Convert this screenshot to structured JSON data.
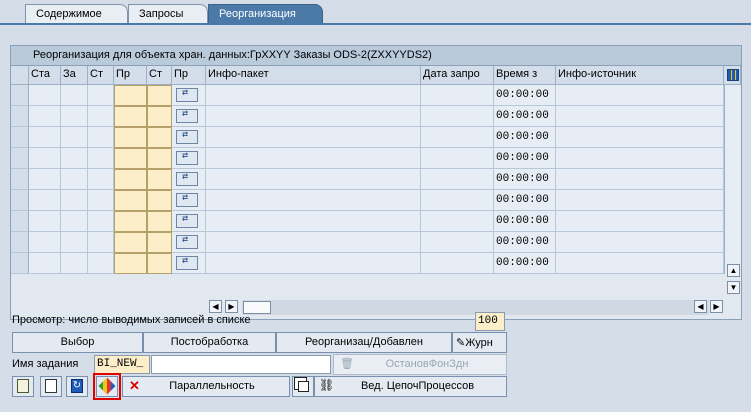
{
  "tabs": [
    {
      "label": "Содержимое"
    },
    {
      "label": "Запросы"
    },
    {
      "label": "Реорганизация"
    }
  ],
  "panel": {
    "title": "Реорганизация для объекта хран. данных:ГрXXYY Заказы ODS-2(ZXXYYDS2)"
  },
  "table": {
    "columns": [
      "Ста",
      "За",
      "Ст",
      "Пр",
      "Ст",
      "Пр",
      "Инфо-пакет",
      "Дата запро",
      "Время з",
      "Инфо-источник"
    ],
    "time_value": "00:00:00",
    "row_count": 9
  },
  "footer": {
    "records_label": "Просмотр: число выводимых записей в списке",
    "records_value": "100",
    "select_button": "Выбор",
    "postprocess_button": "Постобработка",
    "reorg_button": "Реорганизац/Добавлен",
    "journal_button": "Журн",
    "job_label": "Имя задания",
    "job_value": "BI_NEW_",
    "stop_bg_button": "ОстановФонЗдн",
    "parallel_button": "Параллельность",
    "process_chain_button": "Вед. ЦепочПроцессов"
  },
  "colors": {
    "tab_active": "#4b7aa8",
    "highlight_box": "#e00000",
    "input_yellow": "#fbeec9"
  }
}
